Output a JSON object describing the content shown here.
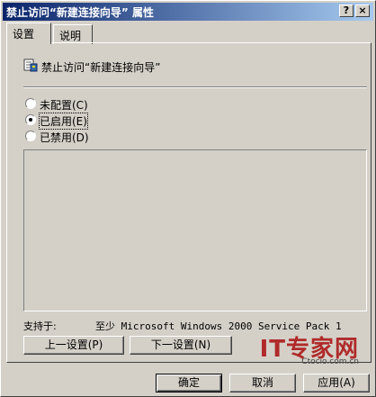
{
  "window": {
    "title": "禁止访问“新建连接向导” 属性",
    "help_button": "?",
    "close_button": "×"
  },
  "tabs": [
    {
      "label": "设置",
      "active": true
    },
    {
      "label": "说明",
      "active": false
    }
  ],
  "policy": {
    "icon": "policy-setting-icon",
    "title": "禁止访问“新建连接向导”"
  },
  "options": [
    {
      "label": "未配置(C)",
      "checked": false
    },
    {
      "label": "已启用(E)",
      "checked": true
    },
    {
      "label": "已禁用(D)",
      "checked": false
    }
  ],
  "supported": {
    "label": "支持于:",
    "value": "至少 Microsoft Windows 2000 Service Pack 1"
  },
  "nav_buttons": {
    "prev": "上一设置(P)",
    "next": "下一设置(N)"
  },
  "footer_buttons": {
    "ok": "确定",
    "cancel": "取消",
    "apply": "应用(A)"
  },
  "watermark": {
    "main": "IT专家网",
    "sub": "Ctocio.com.cn"
  },
  "colors": {
    "title_start": "#0a246a",
    "title_end": "#a6caf0",
    "face": "#d4d0c8",
    "watermark": "#b02a2a"
  }
}
